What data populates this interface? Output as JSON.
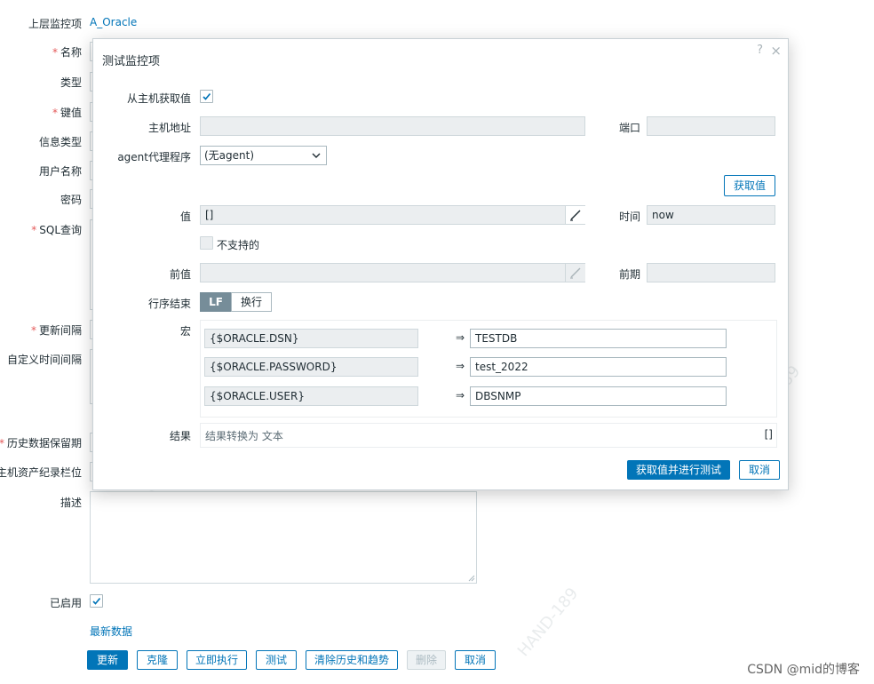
{
  "form": {
    "parent_label": "上层监控项",
    "parent_value": "A_Oracle",
    "labels": {
      "name": "名称",
      "type": "类型",
      "key": "键值",
      "info_type": "信息类型",
      "username": "用户名称",
      "password": "密码",
      "sql": "SQL查询",
      "interval": "更新间隔",
      "custom_interval": "自定义时间间隔",
      "history": "历史数据保留期",
      "inventory": "主机资产纪录栏位",
      "description": "描述",
      "enabled": "已启用"
    },
    "required_mark": "*",
    "enabled": true,
    "latest_data_link": "最新数据"
  },
  "buttons": {
    "update": "更新",
    "clone": "克隆",
    "execute_now": "立即执行",
    "test": "测试",
    "clear_history": "清除历史和趋势",
    "delete": "删除",
    "cancel": "取消"
  },
  "dialog": {
    "title": "测试监控项",
    "help_icon": "?",
    "close_icon": "×",
    "get_from_host_label": "从主机获取值",
    "get_from_host_checked": true,
    "host_address_label": "主机地址",
    "host_address_value": "",
    "port_label": "端口",
    "port_value": "",
    "agent_proxy_label": "agent代理程序",
    "agent_proxy_value": "(无agent)",
    "get_value_button": "获取值",
    "value_label": "值",
    "value_value": "[]",
    "time_label": "时间",
    "time_value": "now",
    "not_supported_label": "不支持的",
    "not_supported_checked": false,
    "prev_value_label": "前值",
    "prev_value_value": "",
    "prev_time_label": "前期",
    "prev_time_value": "",
    "eol_label": "行序结束",
    "eol_options": [
      "LF",
      "换行"
    ],
    "eol_selected": "LF",
    "macros_label": "宏",
    "macro_arrow": "⇒",
    "macros": [
      {
        "name": "{$ORACLE.DSN}",
        "value": "TESTDB"
      },
      {
        "name": "{$ORACLE.PASSWORD}",
        "value": "test_2022"
      },
      {
        "name": "{$ORACLE.USER}",
        "value": "DBSNMP"
      }
    ],
    "result_label": "结果",
    "result_text": "结果转换为 文本",
    "result_value": "[]",
    "submit_button": "获取值并进行测试",
    "cancel_button": "取消"
  },
  "watermark_text": "HAND-189",
  "footer_credit": "CSDN @mid的博客",
  "colors": {
    "accent": "#0275b8",
    "required": "#e45959",
    "segment_active": "#768d99",
    "disabled_field": "#ebeef0"
  }
}
